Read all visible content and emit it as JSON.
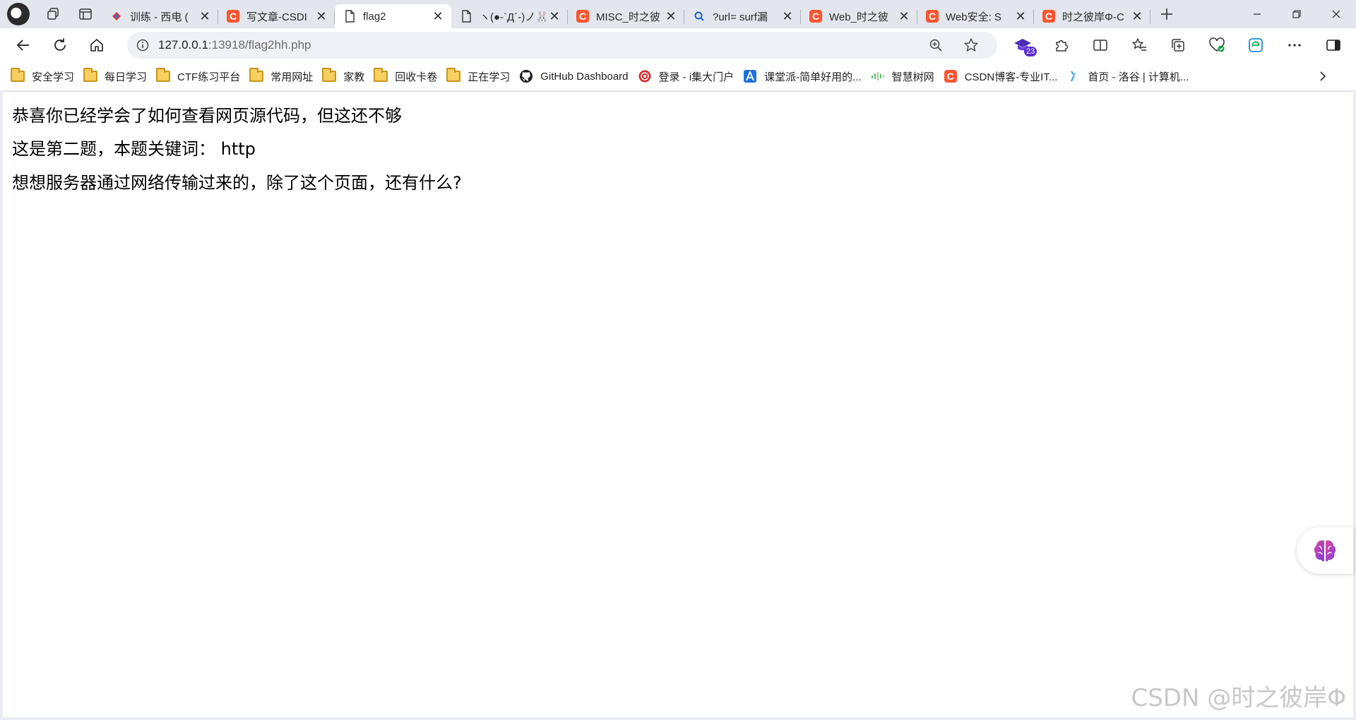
{
  "browser": {
    "tabs": [
      {
        "title": "训练 - 西电 (",
        "icon": "ctf-icon",
        "active": false
      },
      {
        "title": "写文章-CSDI",
        "icon": "csdn-icon",
        "active": false
      },
      {
        "title": "flag2",
        "icon": "page-icon",
        "active": true
      },
      {
        "title": "ヽ(●-`Д´-)ノ🐰",
        "icon": "page-icon",
        "active": false
      },
      {
        "title": "MISC_时之彼",
        "icon": "csdn-icon",
        "active": false
      },
      {
        "title": "?url= surf漏",
        "icon": "search-icon",
        "active": false
      },
      {
        "title": "Web_时之彼",
        "icon": "csdn-icon",
        "active": false
      },
      {
        "title": "Web安全: S",
        "icon": "csdn-icon",
        "active": false
      },
      {
        "title": "时之彼岸Φ-C",
        "icon": "csdn-icon",
        "active": false
      }
    ],
    "address": {
      "host": "127.0.0.1",
      "path": ":13918/flag2hh.php"
    },
    "extension_badge": "23",
    "favorites": [
      {
        "label": "安全学习",
        "icon": "folder-icon"
      },
      {
        "label": "每日学习",
        "icon": "folder-icon"
      },
      {
        "label": "CTF练习平台",
        "icon": "folder-icon"
      },
      {
        "label": "常用网址",
        "icon": "folder-icon"
      },
      {
        "label": "家教",
        "icon": "folder-icon"
      },
      {
        "label": "回收卡卷",
        "icon": "folder-icon"
      },
      {
        "label": "正在学习",
        "icon": "folder-icon"
      },
      {
        "label": "GitHub Dashboard",
        "icon": "github-icon"
      },
      {
        "label": "登录 - i集大门户",
        "icon": "jmu-icon"
      },
      {
        "label": "课堂派-简单好用的...",
        "icon": "ketangpai-icon"
      },
      {
        "label": "智慧树网",
        "icon": "zhihuishu-icon"
      },
      {
        "label": "CSDN博客-专业IT...",
        "icon": "csdn-icon"
      },
      {
        "label": "首页 - 洛谷 | 计算机...",
        "icon": "luogu-icon"
      }
    ]
  },
  "page": {
    "line1": "恭喜你已经学会了如何查看网页源代码，但这还不够",
    "line2": "这是第二题，本题关键词： http",
    "line3": "想想服务器通过网络传输过来的，除了这个页面，还有什么?"
  },
  "watermark": "CSDN @时之彼岸Φ",
  "colors": {
    "csdn_red": "#fc5531",
    "folder_yellow": "#f6cf5f",
    "badge_purple": "#5b2bd6"
  }
}
